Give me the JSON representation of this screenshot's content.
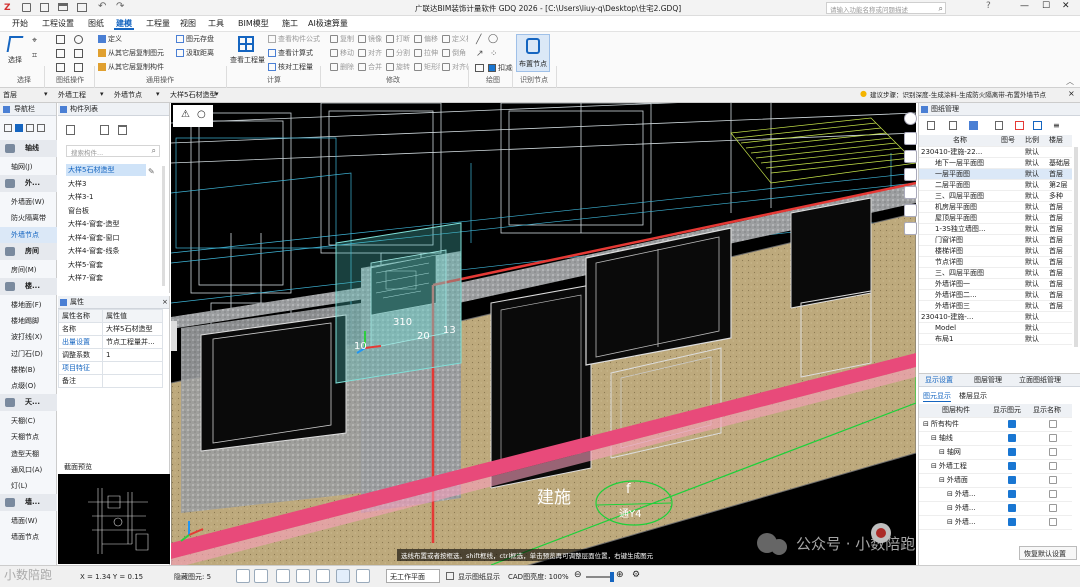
{
  "window": {
    "title": "广联达BIM装饰计量软件 GDQ 2026 - [C:\\Users\\liuy-q\\Desktop\\住宅2.GDQ]",
    "search_placeholder": "请输入功能名称或问题描述"
  },
  "menu": [
    "开始",
    "工程设置",
    "图纸",
    "建模",
    "工程量",
    "视图",
    "工具",
    "BIM模型",
    "施工",
    "AI极速算量"
  ],
  "menu_active": "建模",
  "ribbon": {
    "select": "选择",
    "defs": [
      "定义",
      "从其它层复制图元",
      "从其它层复制构件"
    ],
    "copy_to": "图元存盘",
    "pick": "汲取距离",
    "view_qty": "查看工程量",
    "calc": [
      "查看构件公式",
      "查看计算式",
      "核对工程量"
    ],
    "modify": [
      "复制",
      "移动",
      "删除",
      "镜像",
      "对齐",
      "合并",
      "打断",
      "分割",
      "旋转",
      "偏移",
      "拉伸",
      "矩形阵列",
      "定义构件",
      "倒角",
      "对齐(Alt)"
    ],
    "draw": "扣减",
    "layout": "布置节点",
    "groups": [
      "选择",
      "图纸操作",
      "通用操作",
      "计算",
      "修改",
      "绘图",
      "识别节点"
    ]
  },
  "toolbar_row": {
    "floor": "首层",
    "type1": "外墙工程",
    "type2": "外墙节点",
    "component": "大样5石材造型",
    "hint": "建议步骤：识别深度-生成涂料-生成防火隔离带-布置外墙节点"
  },
  "nav": {
    "title": "导航栏",
    "items": [
      {
        "label": "轴线",
        "cat": true
      },
      {
        "label": "轴网(J)"
      },
      {
        "label": "外...",
        "cat": true
      },
      {
        "label": "外墙面(W)"
      },
      {
        "label": "防火隔离带"
      },
      {
        "label": "外墙节点",
        "sel": true
      },
      {
        "label": "房间",
        "cat": true
      },
      {
        "label": "房间(M)"
      },
      {
        "label": "楼...",
        "cat": true
      },
      {
        "label": "楼地面(F)"
      },
      {
        "label": "楼地踢脚"
      },
      {
        "label": "波打线(X)"
      },
      {
        "label": "过门石(D)"
      },
      {
        "label": "楼梯(B)"
      },
      {
        "label": "点缀(O)"
      },
      {
        "label": "天...",
        "cat": true
      },
      {
        "label": "天棚(C)"
      },
      {
        "label": "天棚节点"
      },
      {
        "label": "造型天棚"
      },
      {
        "label": "通风口(A)"
      },
      {
        "label": "灯(L)"
      },
      {
        "label": "墙...",
        "cat": true
      },
      {
        "label": "墙面(W)"
      },
      {
        "label": "墙面节点"
      }
    ]
  },
  "component_list": {
    "title": "构件列表",
    "search_placeholder": "搜索构件...",
    "items": [
      "大样5石材造型",
      "大样3",
      "大样3-1",
      "窗台板",
      "大样4-窗套-造型",
      "大样4-窗套-窗口",
      "大样4-窗套-线条",
      "大样5-窗套",
      "大样7-窗套"
    ],
    "selected": 0
  },
  "properties": {
    "title": "属性",
    "headers": [
      "属性名称",
      "属性值"
    ],
    "rows": [
      [
        "名称",
        "大样5石材造型"
      ],
      [
        "出量设置",
        "节点工程量并..."
      ],
      [
        "调整系数",
        "1"
      ],
      [
        "项目特征",
        ""
      ],
      [
        "备注",
        ""
      ]
    ]
  },
  "preview": {
    "title": "截面预览"
  },
  "viewport": {
    "tag_big": "建施",
    "circle_top": "f",
    "circle_bottom": "通Y4",
    "dims": [
      "310",
      "20",
      "13",
      "10"
    ]
  },
  "drawing_mgmt": {
    "title": "图纸管理",
    "headers": [
      "名称",
      "图号",
      "比例",
      "楼层"
    ],
    "rows": [
      [
        "230410-建施-22...",
        "",
        "默认",
        ""
      ],
      [
        "地下一层平面图",
        "",
        "默认",
        "基础层"
      ],
      [
        "一层平面图",
        "",
        "默认",
        "首层"
      ],
      [
        "二层平面图",
        "",
        "默认",
        "第2层"
      ],
      [
        "三、四层平面图",
        "",
        "默认",
        "多种"
      ],
      [
        "机房层平面图",
        "",
        "默认",
        "首层"
      ],
      [
        "屋顶层平面图",
        "",
        "默认",
        "首层"
      ],
      [
        "1-3S独立墙图...",
        "",
        "默认",
        "首层"
      ],
      [
        "门窗详图",
        "",
        "默认",
        "首层"
      ],
      [
        "楼梯详图",
        "",
        "默认",
        "首层"
      ],
      [
        "节点详图",
        "",
        "默认",
        "首层"
      ],
      [
        "三、四层平面图",
        "",
        "默认",
        "首层"
      ],
      [
        "外墙详图一",
        "",
        "默认",
        "首层"
      ],
      [
        "外墙详图二...",
        "",
        "默认",
        "首层"
      ],
      [
        "外墙详图三",
        "",
        "默认",
        "首层"
      ],
      [
        "230410-建施-...",
        "",
        "默认",
        ""
      ],
      [
        "Model",
        "",
        "默认",
        ""
      ],
      [
        "布局1",
        "",
        "默认",
        ""
      ]
    ]
  },
  "display": {
    "tabs": [
      "显示设置",
      "图层管理",
      "立面图纸管理"
    ],
    "subtabs": [
      "图元显示",
      "楼层显示"
    ],
    "headers": [
      "图层构件",
      "显示图元",
      "显示名称"
    ],
    "rows": [
      {
        "label": "所有构件",
        "indent": 0,
        "on": true,
        "name": false
      },
      {
        "label": "轴线",
        "indent": 1,
        "on": true,
        "name": false
      },
      {
        "label": "轴网",
        "indent": 2,
        "on": true,
        "name": false
      },
      {
        "label": "外墙工程",
        "indent": 1,
        "on": true,
        "name": false
      },
      {
        "label": "外墙面",
        "indent": 2,
        "on": true,
        "name": false
      },
      {
        "label": "外墙...",
        "indent": 3,
        "on": true,
        "name": false
      },
      {
        "label": "外墙...",
        "indent": 3,
        "on": true,
        "name": false
      },
      {
        "label": "外墙...",
        "indent": 3,
        "on": true,
        "name": false
      }
    ],
    "restore": "恢复默认设置"
  },
  "status": {
    "coords": "X = 1.34 Y = 0.15",
    "hidden_label": "隐藏图元: 5",
    "plane": "无工作平面",
    "show_cad": "显示图纸显示",
    "cad_brightness": "CAD图亮度: 100%",
    "hint": "选线布置或者按框选，shift框线，ctrl框选，单击预览再可调整层面位置，右键生成图元"
  },
  "watermark": {
    "wechat": "公众号 · 小数陪跑",
    "left": "小数陪跑"
  },
  "colors": {
    "accent": "#1565c0",
    "viewport_bg": "#000000",
    "wall_fill": "#b7a77a",
    "red_line": "#e53935",
    "pink_band": "#e84a7a",
    "green": "#1dd13a",
    "cyan": "#7fe0d8"
  }
}
